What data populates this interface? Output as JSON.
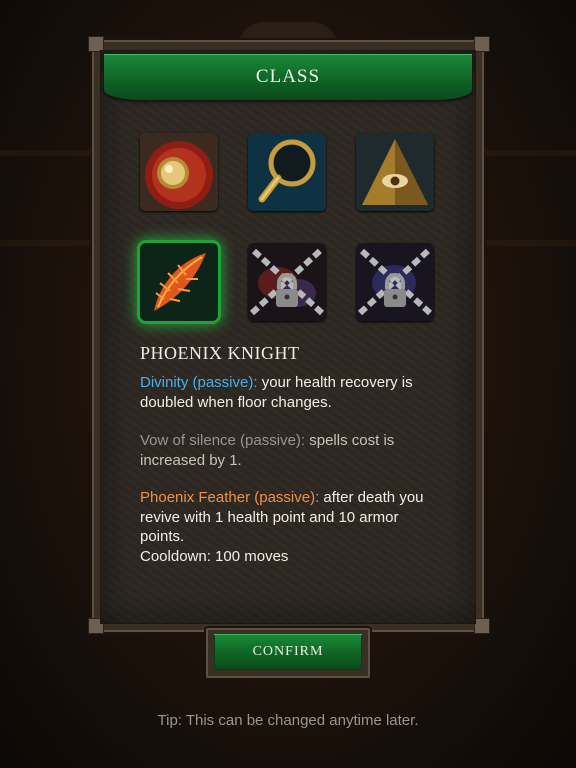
{
  "header": {
    "title": "CLASS"
  },
  "classes": [
    {
      "name": "shield-class",
      "icon": "shield-icon",
      "locked": false
    },
    {
      "name": "magnifier-class",
      "icon": "magnifying-glass-icon",
      "locked": false
    },
    {
      "name": "pyramid-class",
      "icon": "pyramid-eye-icon",
      "locked": false
    },
    {
      "name": "phoenix-knight",
      "icon": "phoenix-feather-icon",
      "locked": false,
      "selected": true
    },
    {
      "name": "locked-class-1",
      "icon": "padlock-chain-icon",
      "locked": true
    },
    {
      "name": "locked-class-2",
      "icon": "padlock-chain-icon",
      "locked": true
    }
  ],
  "selected_class": {
    "name": "PHOENIX KNIGHT",
    "abilities": [
      {
        "keyword": "Divinity (passive):",
        "text": " your health recovery is doubled when floor changes.",
        "color": "#4aaee9"
      },
      {
        "keyword": "Vow of silence (passive):",
        "text": " spells cost is increased by 1.",
        "color": "#9a9590"
      },
      {
        "keyword": "Phoenix Feather (passive):",
        "text": " after death you revive with 1 health point and 10 armor points.",
        "color": "#f19146"
      }
    ],
    "cooldown": "Cooldown: 100 moves"
  },
  "confirm_label": "CONFIRM",
  "tip": "Tip: This can be changed anytime later."
}
